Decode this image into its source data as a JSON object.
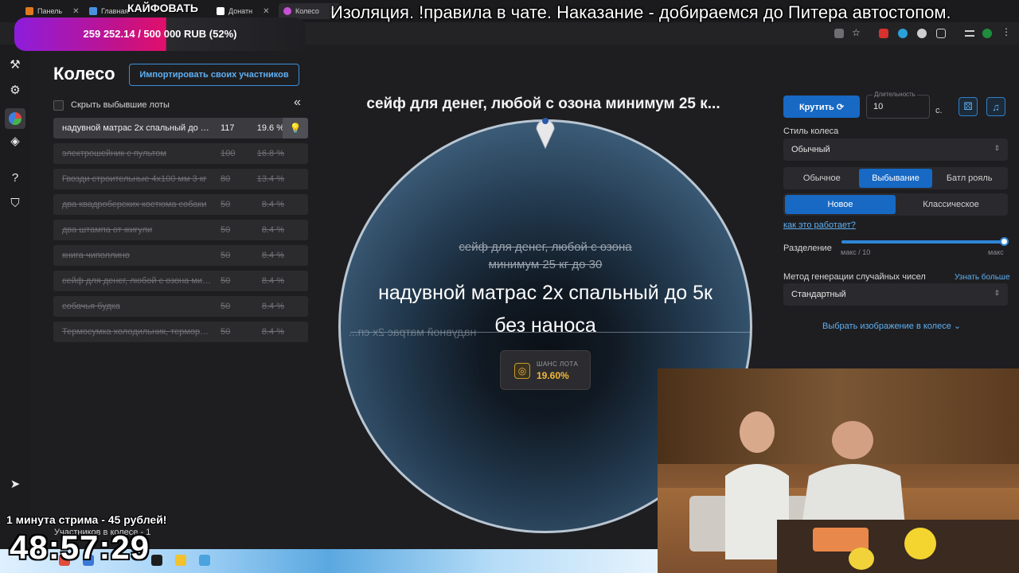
{
  "browser": {
    "tabs": [
      {
        "label": "Панель",
        "color": "#e0781f"
      },
      {
        "label": "Главная",
        "color": "#4a90e2"
      },
      {
        "label": "Донатн",
        "color": "#ffffff"
      },
      {
        "label": "Колесо",
        "color": "#c94fd6"
      }
    ]
  },
  "overlays": {
    "stream_title": "Изоляция. !правила в чате. Наказание - добираемся до Питера автостопом.",
    "kaif": "КАЙФОВАТЬ",
    "donation_goal": "259 252.14 / 500 000 RUB (52%)",
    "donation_progress": 0.52,
    "stream_note": "1 минута стрима - 45 рублей!",
    "timer": "48:57:29"
  },
  "header": {
    "title": "Колесо",
    "import_button": "Импортировать своих участников"
  },
  "lots_panel": {
    "hide_label": "Скрыть выбывшие лоты",
    "collapse_icon": "double-chevron-left",
    "participants": "Участников в колесе - 1",
    "lots": [
      {
        "name": "надувной матрас 2х спальный до 5к без наноса",
        "amount": "117",
        "pct": "19.6 %",
        "active": true
      },
      {
        "name": "электрошейник с пультом",
        "amount": "100",
        "pct": "16.8 %",
        "active": false
      },
      {
        "name": "Гвозди строительные 4х100 мм 3 кг",
        "amount": "80",
        "pct": "13.4 %",
        "active": false
      },
      {
        "name": "два квадроберских костюма собаки",
        "amount": "50",
        "pct": "8.4 %",
        "active": false
      },
      {
        "name": "два штампа от жигули",
        "amount": "50",
        "pct": "8.4 %",
        "active": false
      },
      {
        "name": "книга чиполлино",
        "amount": "50",
        "pct": "8.4 %",
        "active": false
      },
      {
        "name": "сейф для денег, любой с озона минимум 25 кг до 30",
        "amount": "50",
        "pct": "8.4 %",
        "active": false
      },
      {
        "name": "собачья будка",
        "amount": "50",
        "pct": "8.4 %",
        "active": false
      },
      {
        "name": "Термосумка холодильник, терморюкзак",
        "amount": "50",
        "pct": "8.4 %",
        "active": false
      }
    ]
  },
  "wheel": {
    "current_title": "сейф для денег, любой с озона минимум 25 к...",
    "struck_line1": "сейф для денег, любой с озона",
    "struck_line2": "минимум 25 кг до 30",
    "winner_line1": "надувной матрас 2х спальный до 5к",
    "winner_line2": "без наноса",
    "mirrored_text": "надувной матрас 2х сп...",
    "chance_label": "ШАНС ЛОТА",
    "chance_value": "19.60%"
  },
  "controls": {
    "spin_button": "Крутить",
    "duration_label": "Длительность",
    "duration_value": "10",
    "duration_unit": "с.",
    "style_label": "Стиль колеса",
    "style_value": "Обычный",
    "mode_options": [
      "Обычное",
      "Выбывание",
      "Батл рояль"
    ],
    "mode_selected": 1,
    "variant_options": [
      "Новое",
      "Классическое"
    ],
    "variant_selected": 0,
    "how_link": "как это работает?",
    "split_label": "Разделение",
    "split_min": "макс / 10",
    "split_max": "макс",
    "split_level": 1.0,
    "rng_label": "Метод генерации случайных чисел",
    "rng_more": "Узнать больше",
    "rng_value": "Стандартный",
    "image_link": "Выбрать изображение в колесе"
  },
  "colors": {
    "accent": "#1769c4",
    "link": "#5fb0f2",
    "chance": "#f5b835"
  }
}
